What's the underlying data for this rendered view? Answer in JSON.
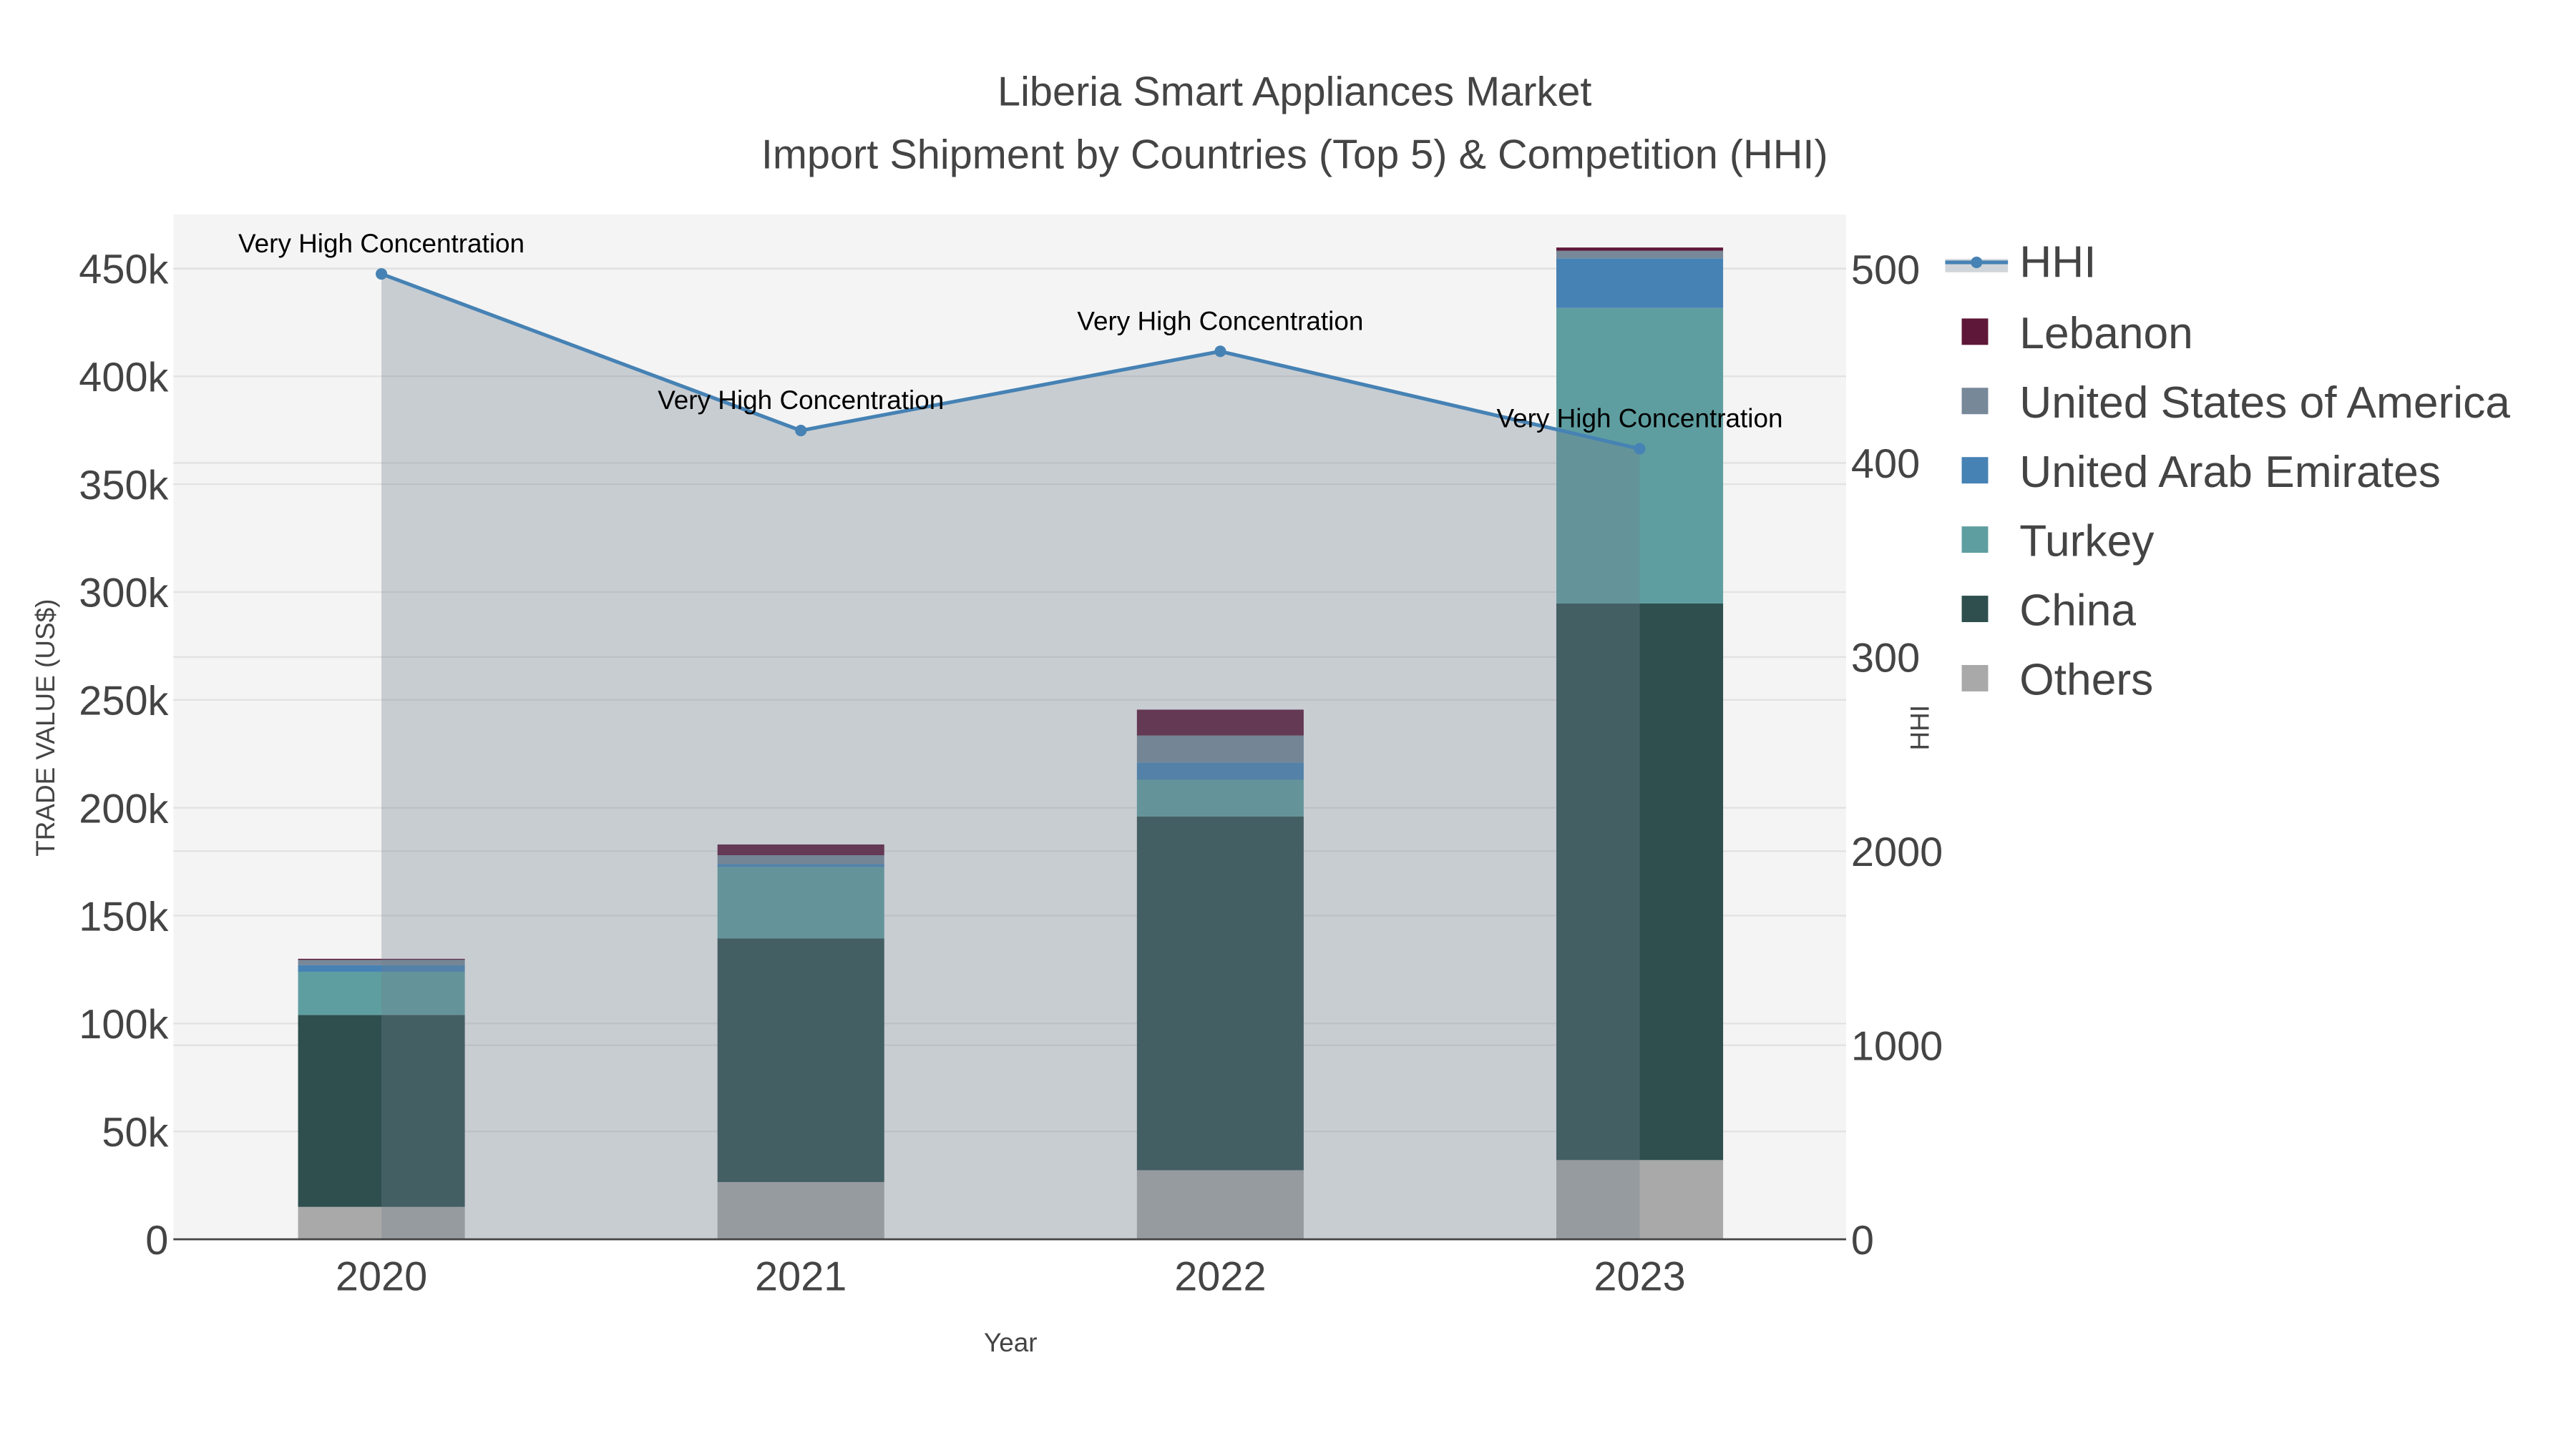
{
  "chart_data": {
    "type": "bar",
    "stacked": true,
    "title": "Liberia Smart Appliances Market",
    "subtitle": "Import Shipment by Countries (Top 5) & Competition (HHI)",
    "xlabel": "Year",
    "ylabel": "TRADE VALUE (US$)",
    "y2label": "HHI",
    "categories": [
      "2020",
      "2021",
      "2022",
      "2023"
    ],
    "ylim": [
      0,
      475000
    ],
    "y_ticks": [
      0,
      50000,
      100000,
      150000,
      200000,
      250000,
      300000,
      350000,
      400000,
      450000
    ],
    "y_tick_labels": [
      "0",
      "50k",
      "100k",
      "150k",
      "200k",
      "250k",
      "300k",
      "350k",
      "400k",
      "450k"
    ],
    "y2lim": [
      0,
      5280
    ],
    "y2_ticks": [
      0,
      1000,
      2000,
      3000,
      4000,
      5000
    ],
    "y2_tick_labels": [
      "0",
      "1000",
      "2000",
      "300",
      "400",
      "500"
    ],
    "grid": true,
    "legend_position": "right",
    "series": [
      {
        "name": "Others",
        "color": "#a9a9a9",
        "values": [
          15000,
          26500,
          32000,
          36700
        ]
      },
      {
        "name": "China",
        "color": "#2f4f4f",
        "values": [
          89000,
          113000,
          164000,
          258000
        ]
      },
      {
        "name": "Turkey",
        "color": "#5f9ea0",
        "values": [
          20000,
          33000,
          17000,
          137000
        ]
      },
      {
        "name": "United Arab Emirates",
        "color": "#4682b4",
        "values": [
          3000,
          1500,
          8000,
          23000
        ]
      },
      {
        "name": "United States of America",
        "color": "#778899",
        "values": [
          2500,
          4000,
          12500,
          3500
        ]
      },
      {
        "name": "Lebanon",
        "color": "#5e1738",
        "values": [
          500,
          5000,
          12000,
          1500
        ]
      }
    ],
    "line": {
      "name": "HHI",
      "color": "#4682b4",
      "values": [
        4974,
        4167,
        4575,
        4073
      ],
      "annotations": [
        "Very High Concentration",
        "Very High Concentration",
        "Very High Concentration",
        "Very High Concentration"
      ]
    }
  }
}
